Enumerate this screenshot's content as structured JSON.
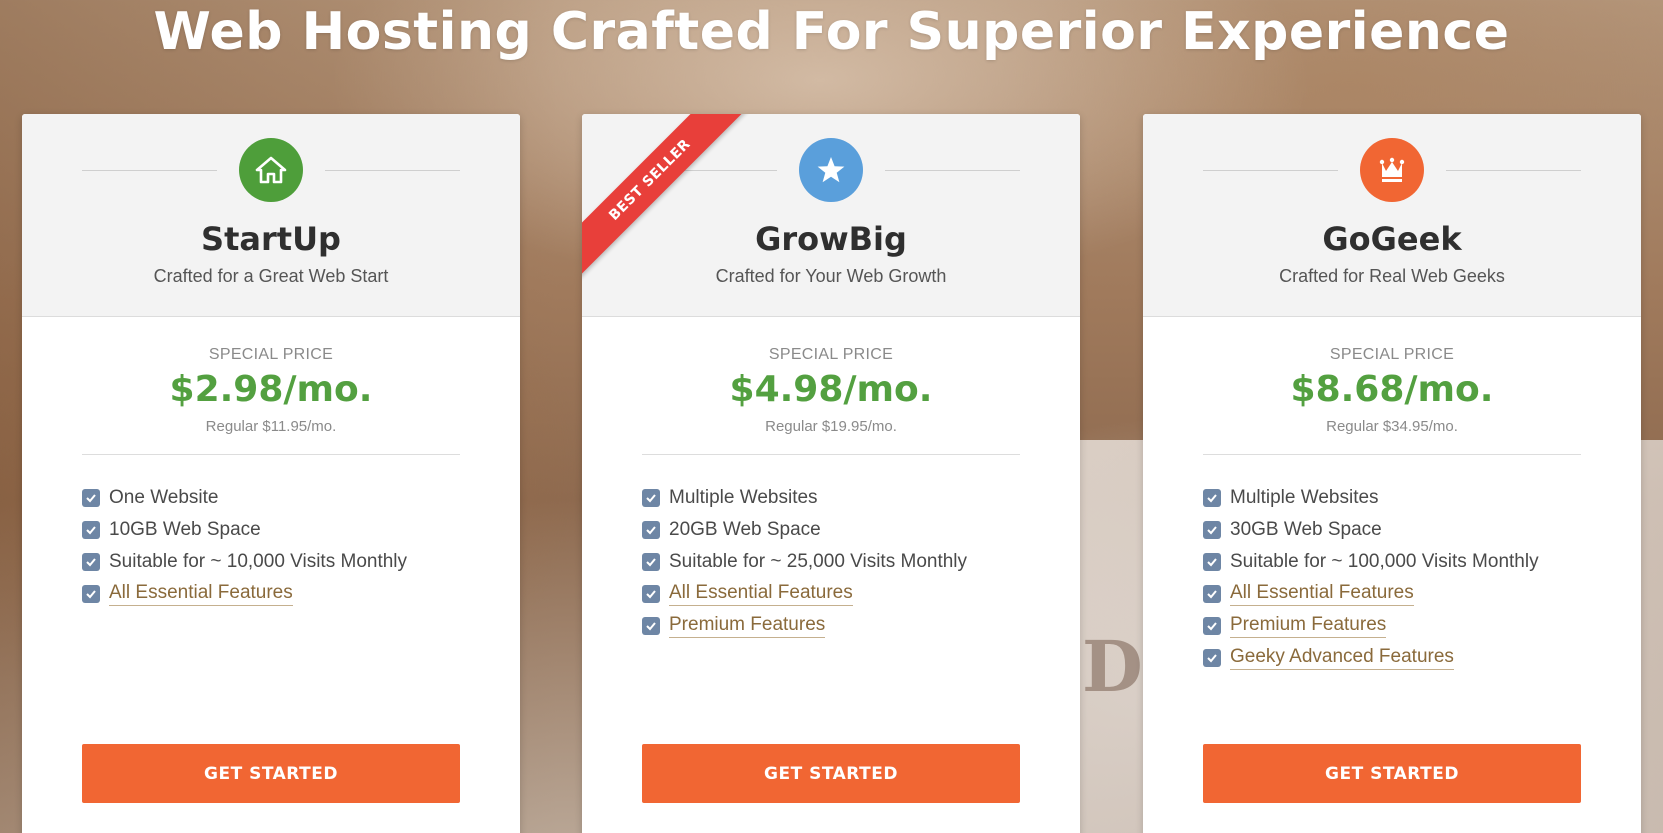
{
  "headline": "Web Hosting Crafted For Superior Experience",
  "plans": [
    {
      "name": "StartUp",
      "subtitle": "Crafted for a Great Web Start",
      "icon": "house-icon",
      "icon_color": "#4e9e3a",
      "special_label": "SPECIAL PRICE",
      "price": "$2.98/mo.",
      "regular": "Regular $11.95/mo.",
      "features": [
        {
          "text": "One Website",
          "link": false
        },
        {
          "text": "10GB Web Space",
          "link": false
        },
        {
          "text": "Suitable for ~ 10,000 Visits Monthly",
          "link": false
        },
        {
          "text": "All Essential Features",
          "link": true
        }
      ],
      "cta": "GET STARTED"
    },
    {
      "name": "GrowBig",
      "subtitle": "Crafted for Your Web Growth",
      "icon": "star-icon",
      "icon_color": "#5a9fdb",
      "ribbon": "BEST SELLER",
      "special_label": "SPECIAL PRICE",
      "price": "$4.98/mo.",
      "regular": "Regular $19.95/mo.",
      "features": [
        {
          "text": "Multiple Websites",
          "link": false
        },
        {
          "text": "20GB Web Space",
          "link": false
        },
        {
          "text": "Suitable for ~ 25,000 Visits Monthly",
          "link": false
        },
        {
          "text": "All Essential Features",
          "link": true
        },
        {
          "text": "Premium Features",
          "link": true
        }
      ],
      "cta": "GET STARTED"
    },
    {
      "name": "GoGeek",
      "subtitle": "Crafted for Real Web Geeks",
      "icon": "crown-icon",
      "icon_color": "#f16633",
      "special_label": "SPECIAL PRICE",
      "price": "$8.68/mo.",
      "regular": "Regular $34.95/mo.",
      "features": [
        {
          "text": "Multiple Websites",
          "link": false
        },
        {
          "text": "30GB Web Space",
          "link": false
        },
        {
          "text": "Suitable for ~ 100,000 Visits Monthly",
          "link": false
        },
        {
          "text": "All Essential Features",
          "link": true
        },
        {
          "text": "Premium Features",
          "link": true
        },
        {
          "text": "Geeky Advanced Features",
          "link": true
        }
      ],
      "cta": "GET STARTED"
    }
  ]
}
